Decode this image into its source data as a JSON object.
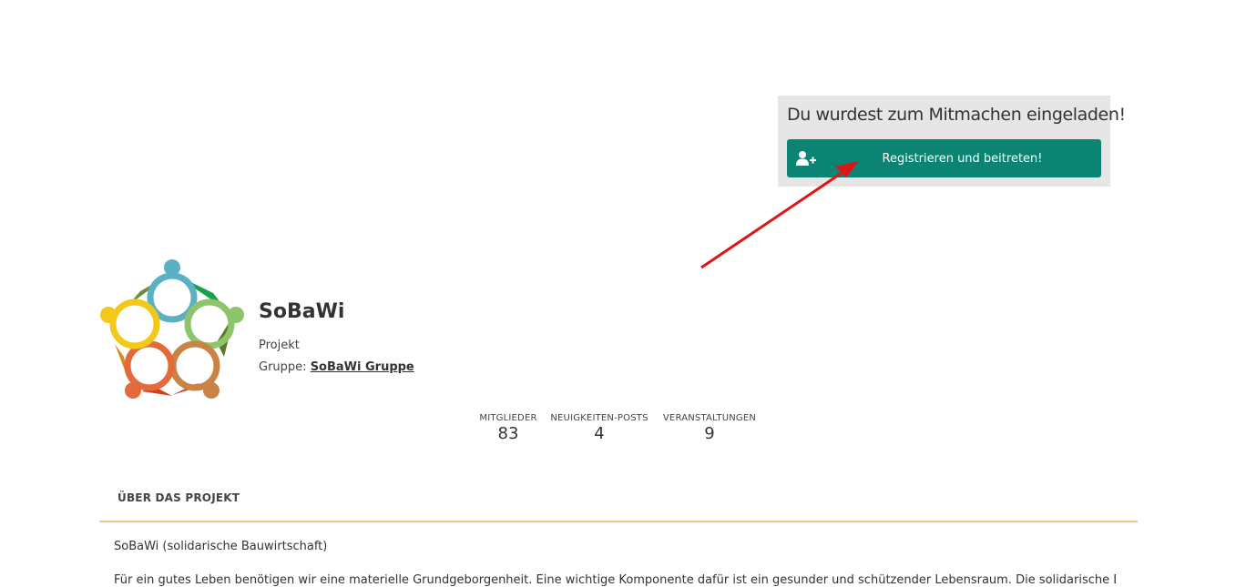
{
  "invite": {
    "title": "Du wurdest zum Mitmachen eingeladen!",
    "button_label": "Registrieren und beitreten!",
    "button_icon": "user-plus-icon",
    "accent_color": "#0b8474"
  },
  "project": {
    "name": "SoBaWi",
    "type": "Projekt",
    "group_prefix": "Gruppe:",
    "group_link": "SoBaWi Gruppe"
  },
  "stats": [
    {
      "label": "MITGLIEDER",
      "value": "83"
    },
    {
      "label": "NEUIGKEITEN-POSTS",
      "value": "4"
    },
    {
      "label": "VERANSTALTUNGEN",
      "value": "9"
    }
  ],
  "about": {
    "heading": "ÜBER DAS PROJEKT",
    "paragraph1": "SoBaWi (solidarische Bauwirtschaft)",
    "paragraph2": "Für ein gutes Leben benötigen wir eine materielle Grundgeborgenheit. Eine wichtige Komponente dafür ist ein gesunder und schützender Lebensraum. Die solidarische Bauwirtschaft"
  }
}
